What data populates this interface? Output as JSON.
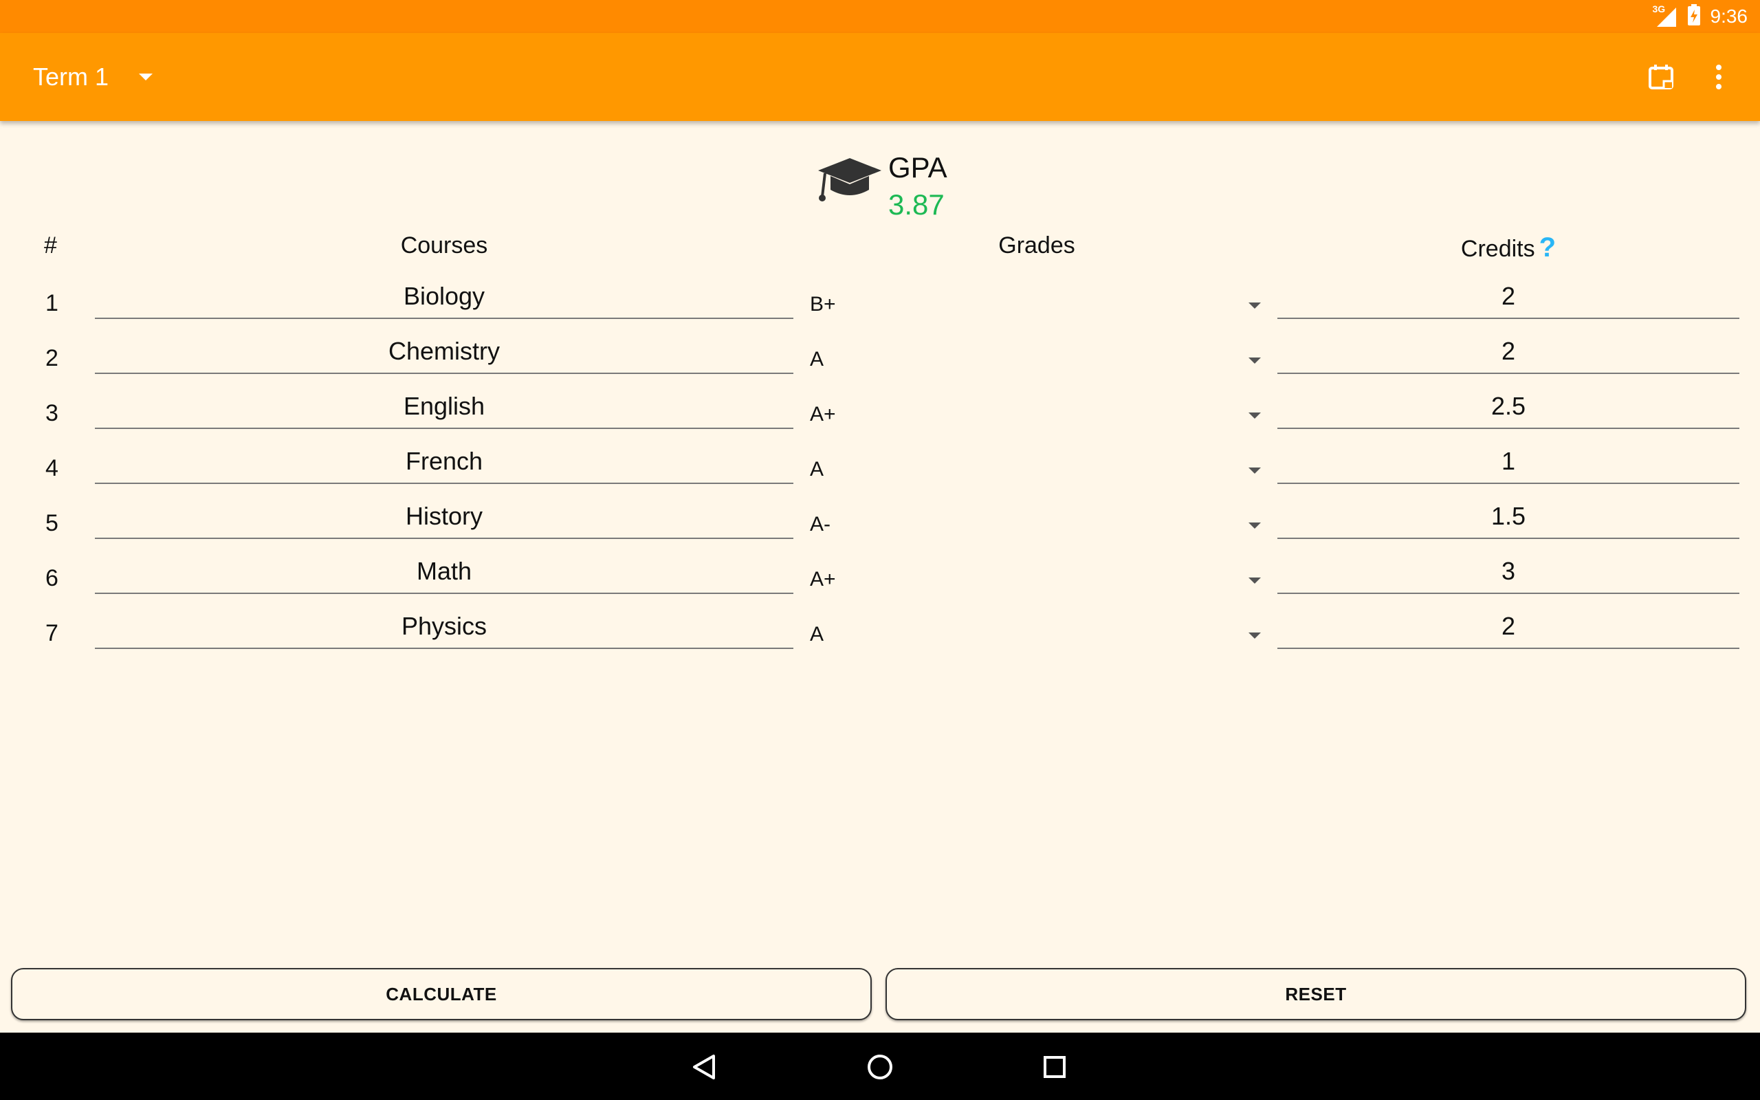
{
  "status_bar": {
    "time": "9:36",
    "network_label": "3G",
    "signal_icon": "cell-signal-icon",
    "battery_icon": "battery-charging-icon"
  },
  "app_bar": {
    "term_selected": "Term 1",
    "dropdown_icon": "chevron-down-icon",
    "actions": [
      "calendar-icon",
      "more-vert-icon"
    ],
    "background_color": "#ff9800"
  },
  "gpa": {
    "label": "GPA",
    "value": "3.87",
    "value_color": "#1db954",
    "icon": "graduation-cap-icon"
  },
  "table": {
    "headers": {
      "number": "#",
      "courses": "Courses",
      "grades": "Grades",
      "credits": "Credits",
      "credits_help": "?"
    },
    "rows": [
      {
        "num": "1",
        "course": "Biology",
        "grade": "B+",
        "credits": "2"
      },
      {
        "num": "2",
        "course": "Chemistry",
        "grade": "A",
        "credits": "2"
      },
      {
        "num": "3",
        "course": "English",
        "grade": "A+",
        "credits": "2.5"
      },
      {
        "num": "4",
        "course": "French",
        "grade": "A",
        "credits": "1"
      },
      {
        "num": "5",
        "course": "History",
        "grade": "A-",
        "credits": "1.5"
      },
      {
        "num": "6",
        "course": "Math",
        "grade": "A+",
        "credits": "3"
      },
      {
        "num": "7",
        "course": "Physics",
        "grade": "A",
        "credits": "2"
      }
    ]
  },
  "buttons": {
    "calculate": "CALCULATE",
    "reset": "RESET"
  },
  "nav_bar": {
    "icons": [
      "back-icon",
      "home-icon",
      "recents-icon"
    ]
  }
}
